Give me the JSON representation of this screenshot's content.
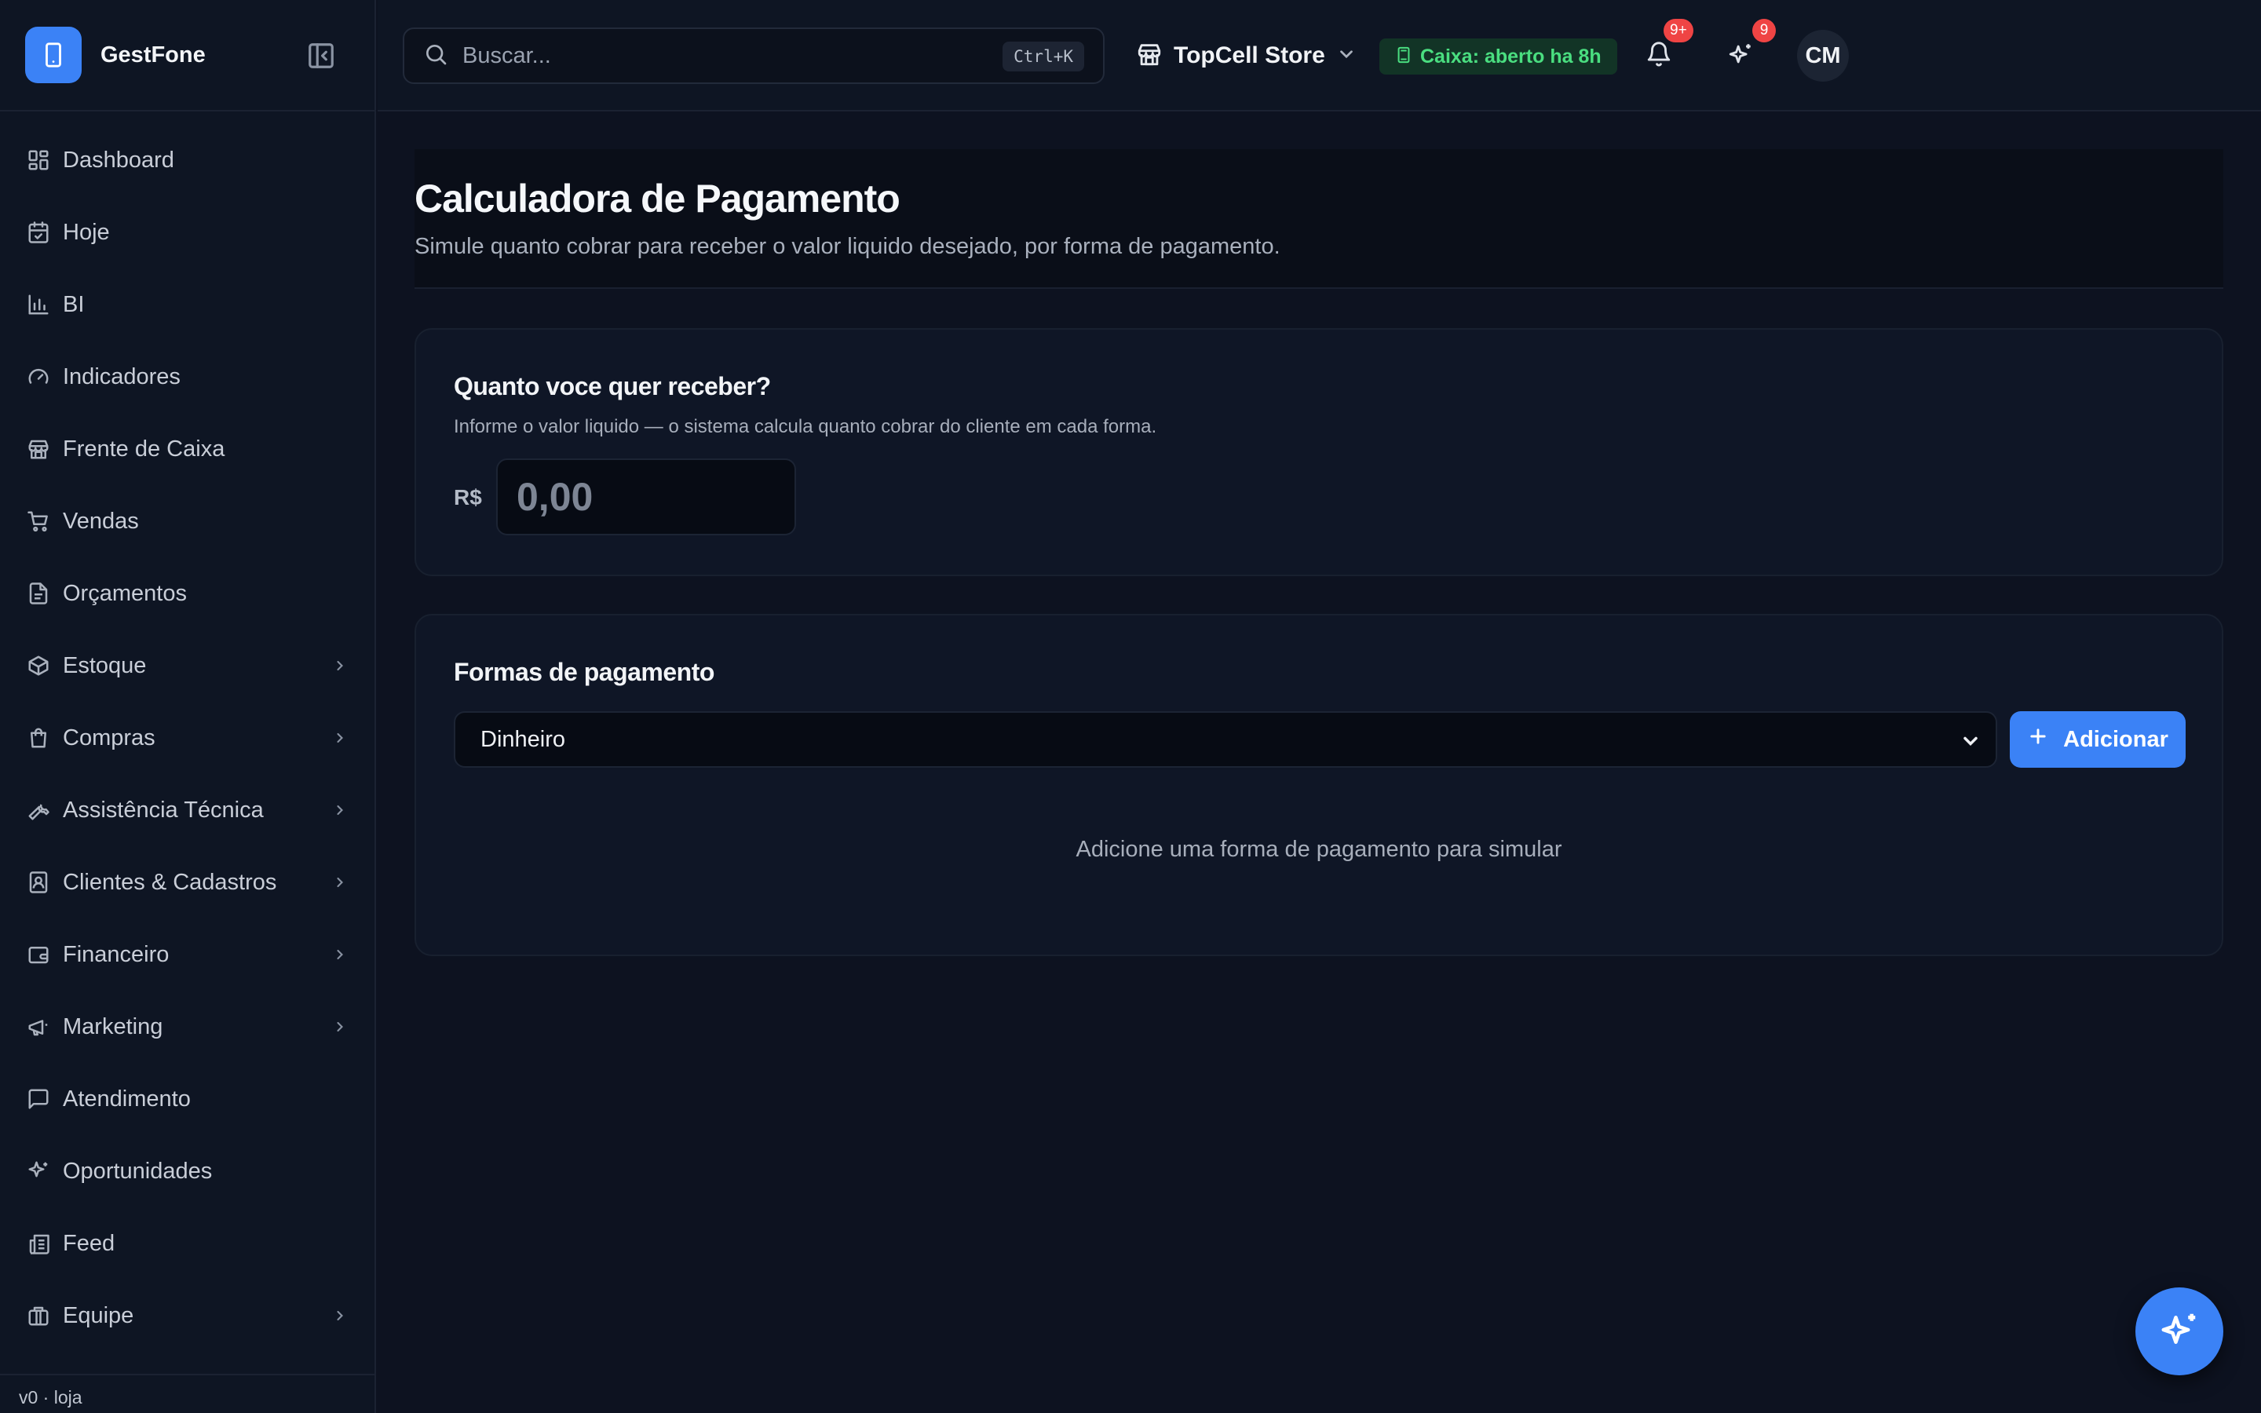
{
  "app": {
    "name": "GestFone",
    "version": "v0 · loja"
  },
  "colors": {
    "accent": "#3b82f6",
    "success": "#4ade80",
    "danger": "#ef4444"
  },
  "sidebar": {
    "items": [
      {
        "label": "Dashboard",
        "icon": "dashboard-icon",
        "has_submenu": false
      },
      {
        "label": "Hoje",
        "icon": "calendar-check-icon",
        "has_submenu": false
      },
      {
        "label": "BI",
        "icon": "bar-chart-icon",
        "has_submenu": false
      },
      {
        "label": "Indicadores",
        "icon": "gauge-icon",
        "has_submenu": false
      },
      {
        "label": "Frente de Caixa",
        "icon": "store-icon",
        "has_submenu": false
      },
      {
        "label": "Vendas",
        "icon": "cart-icon",
        "has_submenu": false
      },
      {
        "label": "Orçamentos",
        "icon": "file-text-icon",
        "has_submenu": false
      },
      {
        "label": "Estoque",
        "icon": "package-icon",
        "has_submenu": true
      },
      {
        "label": "Compras",
        "icon": "shopping-bag-icon",
        "has_submenu": true
      },
      {
        "label": "Assistência Técnica",
        "icon": "wrench-icon",
        "has_submenu": true
      },
      {
        "label": "Clientes & Cadastros",
        "icon": "contact-icon",
        "has_submenu": true
      },
      {
        "label": "Financeiro",
        "icon": "wallet-icon",
        "has_submenu": true
      },
      {
        "label": "Marketing",
        "icon": "megaphone-icon",
        "has_submenu": true
      },
      {
        "label": "Atendimento",
        "icon": "message-square-icon",
        "has_submenu": false
      },
      {
        "label": "Oportunidades",
        "icon": "sparkles-icon",
        "has_submenu": false
      },
      {
        "label": "Feed",
        "icon": "newspaper-icon",
        "has_submenu": false
      },
      {
        "label": "Equipe",
        "icon": "briefcase-icon",
        "has_submenu": true
      }
    ]
  },
  "topbar": {
    "search": {
      "placeholder": "Buscar...",
      "shortcut": "Ctrl+K"
    },
    "store": {
      "name": "TopCell Store"
    },
    "cash_status": "Caixa: aberto ha 8h",
    "notifications_badge": "9+",
    "ai_badge": "9",
    "avatar_initials": "CM"
  },
  "page": {
    "title": "Calculadora de Pagamento",
    "subtitle": "Simule quanto cobrar para receber o valor liquido desejado, por forma de pagamento."
  },
  "amount_card": {
    "title": "Quanto voce quer receber?",
    "description": "Informe o valor liquido — o sistema calcula quanto cobrar do cliente em cada forma.",
    "currency": "R$",
    "placeholder": "0,00"
  },
  "payment_card": {
    "title": "Formas de pagamento",
    "selected_method": "Dinheiro",
    "add_label": "Adicionar",
    "empty_message": "Adicione uma forma de pagamento para simular"
  }
}
